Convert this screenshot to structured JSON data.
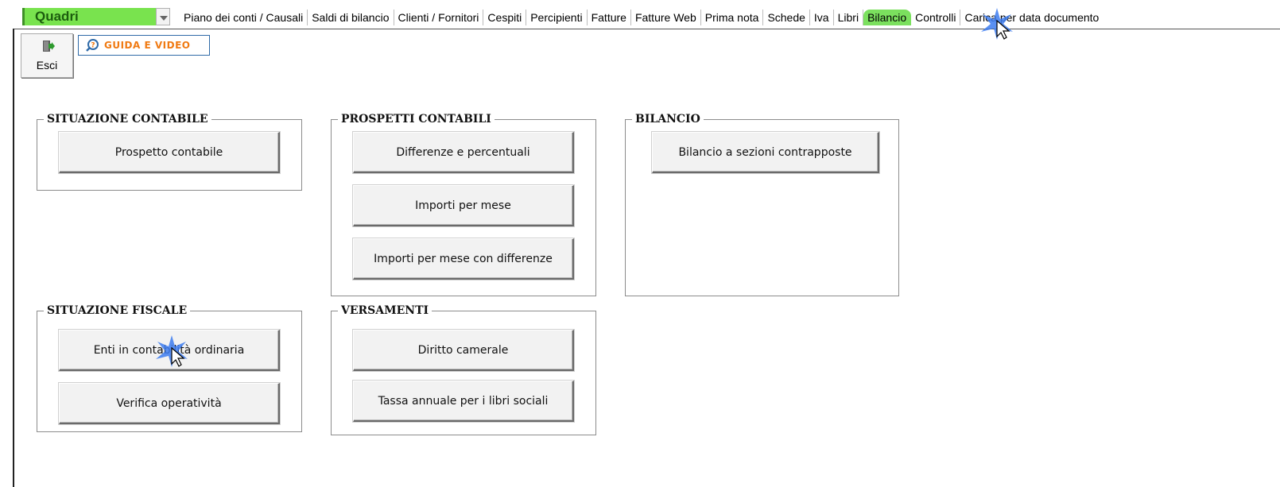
{
  "menu": {
    "quadri_label": "Quadri",
    "items": [
      {
        "label": "Piano dei conti / Causali"
      },
      {
        "label": "Saldi di bilancio"
      },
      {
        "label": "Clienti / Fornitori"
      },
      {
        "label": "Cespiti"
      },
      {
        "label": "Percipienti"
      },
      {
        "label": "Fatture"
      },
      {
        "label": "Fatture Web"
      },
      {
        "label": "Prima nota"
      },
      {
        "label": "Schede"
      },
      {
        "label": "Iva"
      },
      {
        "label": "Libri"
      },
      {
        "label": "Bilancio",
        "active": true
      },
      {
        "label": "Controlli"
      },
      {
        "label": "Carica per data documento"
      }
    ]
  },
  "toolbar": {
    "exit_label": "Esci",
    "guide_label": "GUIDA E VIDEO"
  },
  "groups": {
    "situazione_contabile": {
      "title": "SITUAZIONE CONTABILE",
      "buttons": [
        "Prospetto contabile"
      ]
    },
    "prospetti_contabili": {
      "title": "PROSPETTI CONTABILI",
      "buttons": [
        "Differenze e percentuali",
        "Importi per mese",
        "Importi per mese con differenze"
      ]
    },
    "bilancio": {
      "title": "BILANCIO",
      "buttons": [
        "Bilancio a sezioni contrapposte"
      ]
    },
    "situazione_fiscale": {
      "title": "SITUAZIONE FISCALE",
      "buttons": [
        "Enti in contabilità ordinaria",
        "Verifica operatività"
      ]
    },
    "versamenti": {
      "title": "VERSAMENTI",
      "buttons": [
        "Diritto camerale",
        "Tassa annuale per i libri sociali"
      ]
    }
  },
  "colors": {
    "active_tab": "#7be05e",
    "quadri_bg": "#79e34e",
    "guide_text": "#f07a12",
    "guide_border": "#2f6aa8",
    "click_highlight": "#3d7df0"
  }
}
